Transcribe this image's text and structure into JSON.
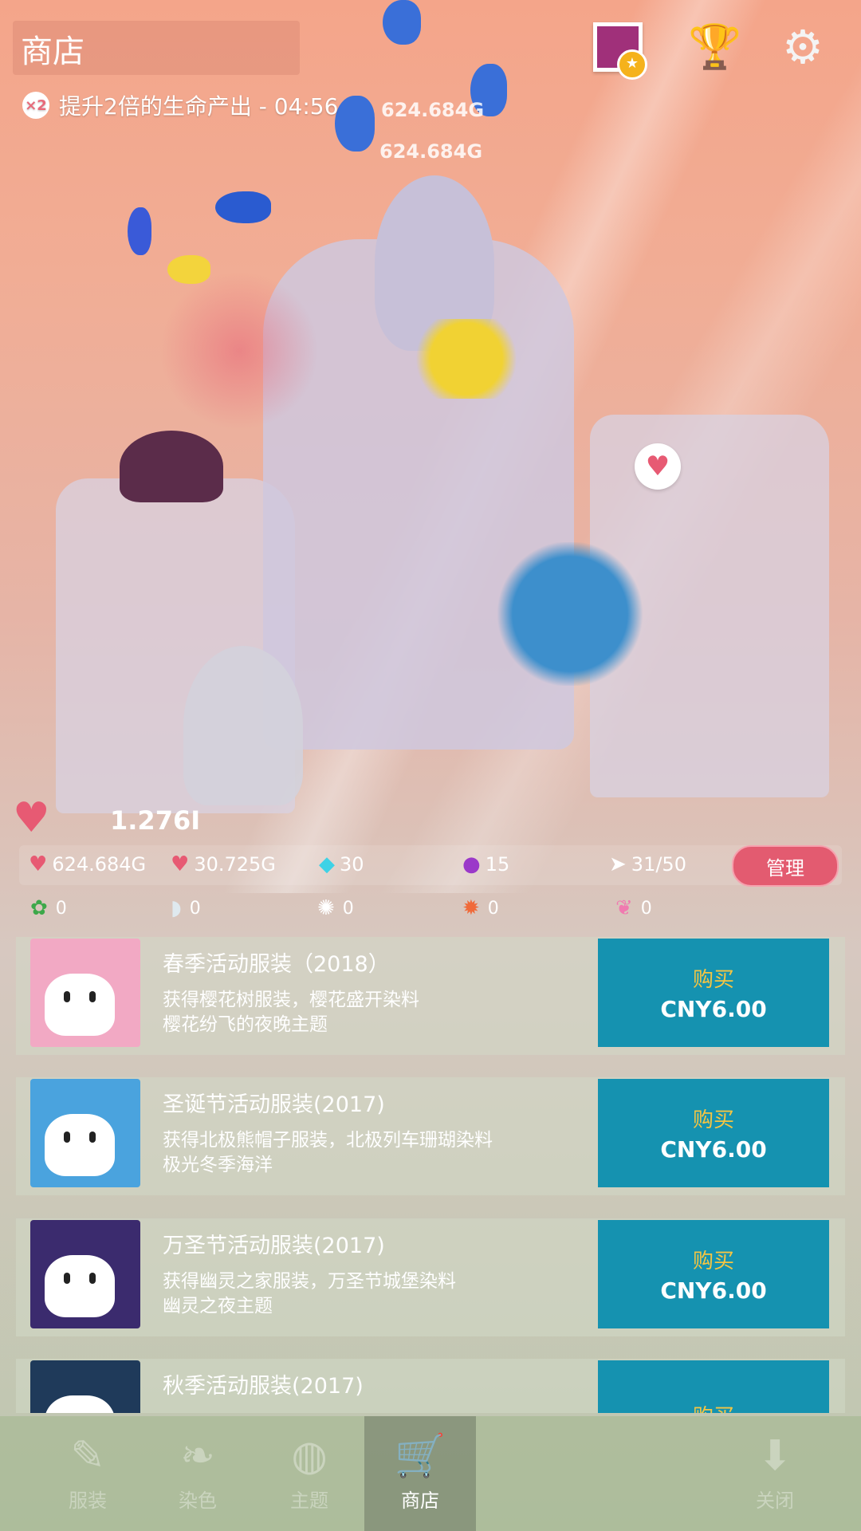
{
  "header": {
    "title": "商店",
    "boost_multiplier": "×2",
    "boost_text": "提升2倍的生命产出 - 04:56"
  },
  "scene": {
    "float_values": [
      "624.684G",
      "624.684G"
    ]
  },
  "stats": {
    "total_life": "1.276I",
    "tap_value": "624.684G",
    "idle_value": "30.725G",
    "gems": "30",
    "pearls": "15",
    "fish_count": "31/50",
    "manage_label": "管理",
    "mini": [
      "0",
      "0",
      "0",
      "0",
      "0"
    ]
  },
  "shop_items": [
    {
      "title": "春季活动服装（2018）",
      "desc_line1": "获得樱花树服装，樱花盛开染料",
      "desc_line2": "樱花纷飞的夜晚主题",
      "buy_label": "购买",
      "price": "CNY6.00",
      "thumb_color": "#f2a9c4"
    },
    {
      "title": "圣诞节活动服装(2017)",
      "desc_line1": "获得北极熊帽子服装，北极列车珊瑚染料",
      "desc_line2": "极光冬季海洋",
      "buy_label": "购买",
      "price": "CNY6.00",
      "thumb_color": "#4aa3de"
    },
    {
      "title": "万圣节活动服装(2017)",
      "desc_line1": "获得幽灵之家服装，万圣节城堡染料",
      "desc_line2": "幽灵之夜主题",
      "buy_label": "购买",
      "price": "CNY6.00",
      "thumb_color": "#3b2b6e"
    },
    {
      "title": "秋季活动服装(2017)",
      "desc_line1": "",
      "desc_line2": "",
      "buy_label": "购买",
      "price": "",
      "thumb_color": "#1f3a5a"
    }
  ],
  "nav": {
    "tabs": [
      "服装",
      "染色",
      "主题",
      "商店",
      "关闭"
    ],
    "active": "商店"
  },
  "colors": {
    "buy_button": "#1592b0",
    "manage_button": "#e35b70",
    "heart": "#e75a73"
  }
}
